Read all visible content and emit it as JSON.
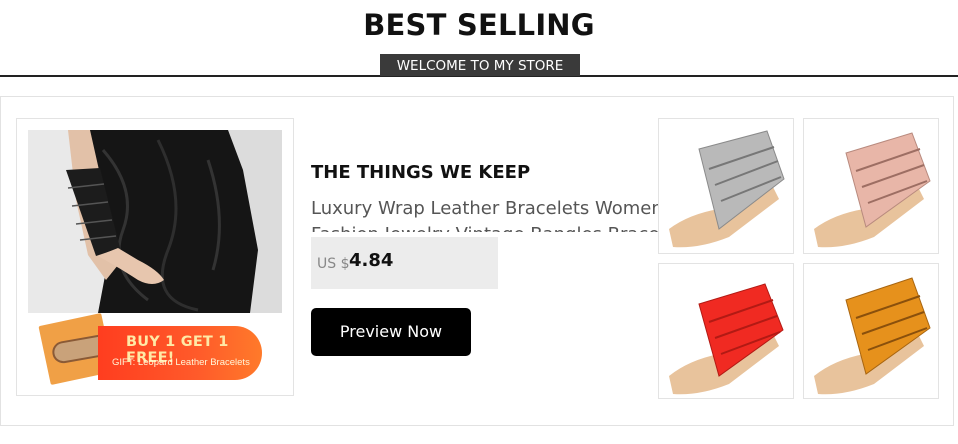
{
  "header": {
    "title": "BEST SELLING",
    "subtitle": "WELCOME TO MY STORE"
  },
  "product": {
    "collection": "THE THINGS WE KEEP",
    "title_line1": "Luxury Wrap Leather Bracelets Women",
    "title_line2": "Fashion Jewelry Vintage Bangles Bracelet",
    "currency": "US $",
    "price": "4.84",
    "cta_label": "Preview Now"
  },
  "promo": {
    "headline": "BUY 1 GET 1 FREE!",
    "detail": "GIFT: Leopard Leather Bracelets"
  },
  "thumbnails": [
    {
      "name": "silver",
      "color": "#b9b9b9"
    },
    {
      "name": "pink",
      "color": "#e8b6a8"
    },
    {
      "name": "red",
      "color": "#f02a22"
    },
    {
      "name": "orange",
      "color": "#e6911c"
    }
  ],
  "colors": {
    "welcome_bg": "#3a3a3a",
    "cta_bg": "#000000",
    "promo_red": "#ff3d1f",
    "promo_text": "#ffe9a6"
  }
}
